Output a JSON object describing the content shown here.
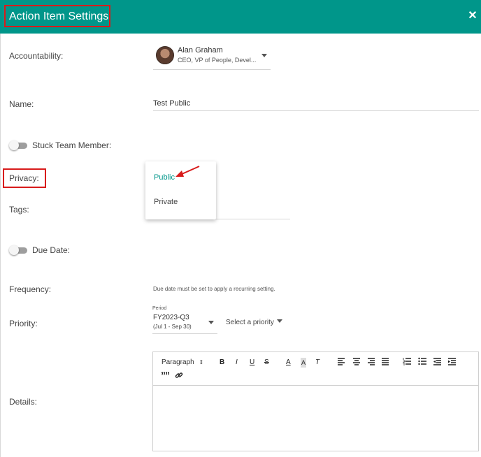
{
  "header": {
    "title": "Action Item Settings",
    "close_icon": "close-icon"
  },
  "accountability": {
    "label": "Accountability:",
    "user_name": "Alan Graham",
    "user_role": "CEO, VP of People, Devel..."
  },
  "name": {
    "label": "Name:",
    "value": "Test Public"
  },
  "stuck": {
    "label": "Stuck Team Member:",
    "on": false
  },
  "privacy": {
    "label": "Privacy:",
    "options": [
      "Public",
      "Private"
    ],
    "selected": "Public"
  },
  "tags": {
    "label": "Tags:"
  },
  "due_date": {
    "label": "Due Date:",
    "on": false
  },
  "frequency": {
    "label": "Frequency:",
    "hint": "Due date must be set to apply a recurring setting."
  },
  "priority": {
    "label": "Priority:",
    "period_label": "Period",
    "period_value": "FY2023-Q3",
    "period_range": "(Jul 1 - Sep 30)",
    "placeholder": "Select a priority"
  },
  "details": {
    "label": "Details:",
    "paragraph_label": "Paragraph",
    "toolbar": {
      "bold": "B",
      "italic": "I",
      "underline": "U",
      "strike": "S",
      "font_color": "A",
      "highlight": "A",
      "clear_format": "T",
      "blockquote": "”"
    }
  },
  "colors": {
    "header": "#00968a",
    "accent": "#00968a",
    "annotation": "#d81b1b"
  }
}
